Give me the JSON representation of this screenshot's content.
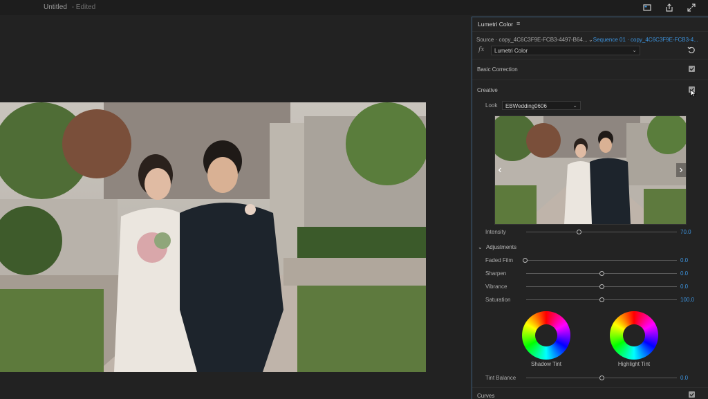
{
  "header": {
    "title": "Untitled",
    "status": "- Edited"
  },
  "icons": {
    "top": [
      "record-icon",
      "share-icon",
      "fullscreen-icon"
    ]
  },
  "panel": {
    "tab": "Lumetri Color",
    "menu_glyph": "≡",
    "source": "Source · copy_4C6C3F9E-FCB3-4497-B64...",
    "sequence": "Sequence 01 · copy_4C6C3F9E-FCB3-4...",
    "fx": "fx",
    "effect": "Lumetri Color",
    "sections": {
      "basic": "Basic Correction",
      "creative": "Creative",
      "curves": "Curves"
    },
    "look": {
      "label": "Look",
      "value": "EBWedding0606"
    },
    "intensity": {
      "label": "Intensity",
      "value": "70.0",
      "level": 70
    },
    "adjustments": {
      "title": "Adjustments",
      "sliders": [
        {
          "label": "Faded Film",
          "value": "0.0",
          "level": 0
        },
        {
          "label": "Sharpen",
          "value": "0.0",
          "level": 50
        },
        {
          "label": "Vibrance",
          "value": "0.0",
          "level": 50
        },
        {
          "label": "Saturation",
          "value": "100.0",
          "level": 50
        }
      ]
    },
    "wheels": {
      "shadow": "Shadow Tint",
      "highlight": "Highlight Tint"
    },
    "tint_balance": {
      "label": "Tint Balance",
      "value": "0.0",
      "level": 50
    }
  },
  "colors": {
    "accent": "#3d95e0",
    "panel_border": "#3f5f7f"
  }
}
